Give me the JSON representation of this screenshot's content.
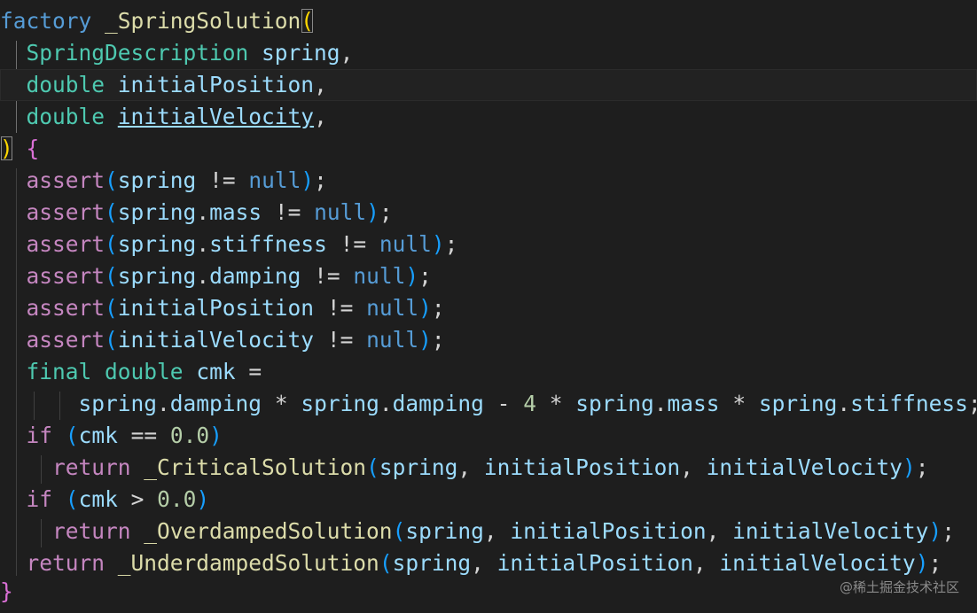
{
  "editor": {
    "lines": [
      {
        "text": "factory _SpringSolution("
      },
      {
        "text": "  SpringDescription spring,"
      },
      {
        "text": "  double initialPosition,"
      },
      {
        "text": "  double initialVelocity,"
      },
      {
        "text": ") {"
      },
      {
        "text": "  assert(spring != null);"
      },
      {
        "text": "  assert(spring.mass != null);"
      },
      {
        "text": "  assert(spring.stiffness != null);"
      },
      {
        "text": "  assert(spring.damping != null);"
      },
      {
        "text": "  assert(initialPosition != null);"
      },
      {
        "text": "  assert(initialVelocity != null);"
      },
      {
        "text": "  final double cmk ="
      },
      {
        "text": "      spring.damping * spring.damping - 4 * spring.mass * spring.stiffness;"
      },
      {
        "text": "  if (cmk == 0.0)"
      },
      {
        "text": "    return _CriticalSolution(spring, initialPosition, initialVelocity);"
      },
      {
        "text": "  if (cmk > 0.0)"
      },
      {
        "text": "    return _OverdampedSolution(spring, initialPosition, initialVelocity);"
      },
      {
        "text": "  return _UnderdampedSolution(spring, initialPosition, initialVelocity);"
      },
      {
        "text": "}"
      }
    ],
    "theme": {
      "background": "#1e1e1e",
      "function": "#dcdcaa",
      "type": "#4ec9b0",
      "variable": "#9cdcfe",
      "keyword": "#c586c0",
      "null": "#569cd6",
      "number": "#b5cea8",
      "bracket_gold": "#ffd700",
      "bracket_orchid": "#da70d6",
      "bracket_blue": "#179fff"
    }
  },
  "watermark": {
    "text": "@稀土掘金技术社区"
  }
}
